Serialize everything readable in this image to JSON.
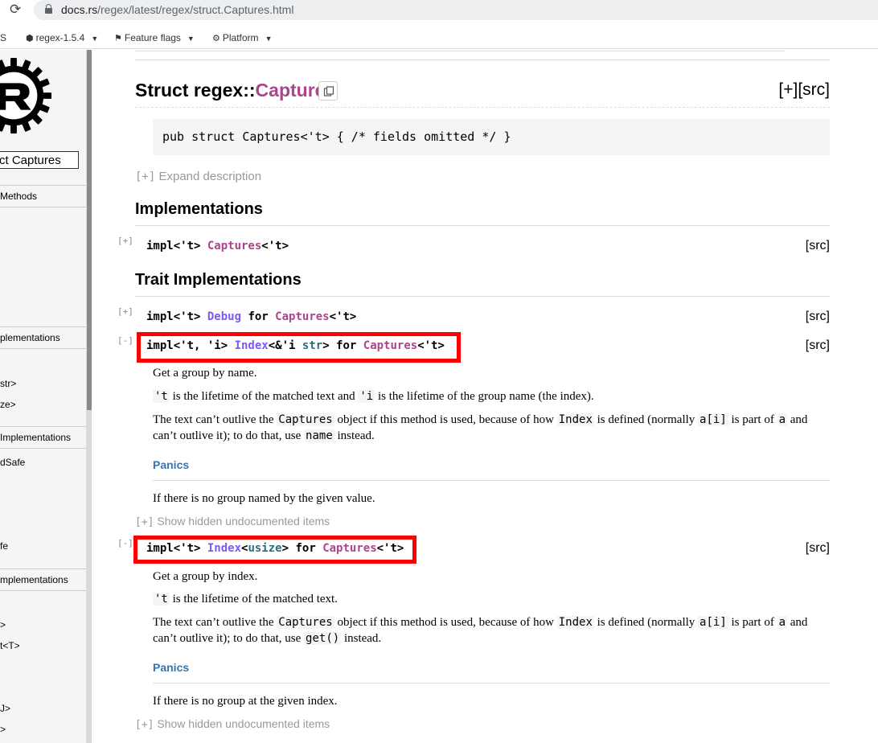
{
  "browser": {
    "url_host": "docs.rs",
    "url_path": "/regex/latest/regex/struct.Captures.html",
    "reload_glyph": "⟳"
  },
  "docsnav": {
    "partial_item": "S",
    "crate_version": "regex-1.5.4",
    "feature_flags": "Feature flags",
    "platform": "Platform",
    "caret": "▼"
  },
  "sidebar": {
    "location": "ct Captures",
    "sections": [
      {
        "label": "Methods"
      },
      {
        "label": "plementations"
      },
      {
        "label": "Implementations"
      },
      {
        "label": "mplementations"
      }
    ],
    "links": [
      "str>",
      "ze>",
      "dSafe",
      "fe",
      ">",
      "t<T>",
      "J>",
      ">"
    ]
  },
  "main": {
    "title_prefix": "Struct regex::",
    "title_name": "Captures",
    "title_src": "[+][src]",
    "declaration": "pub struct Captures<'t> { /* fields omitted */ }",
    "expand_toggle": "[+]",
    "expand_label": "Expand description",
    "implementations_heading": "Implementations",
    "trait_impls_heading": "Trait Implementations",
    "src_label": "[src]",
    "toggle_plus": "[+]",
    "toggle_minus": "[-]",
    "impls": [
      {
        "tokens": [
          [
            "k",
            "impl<'t> "
          ],
          [
            "ty",
            "Captures"
          ],
          [
            "k",
            "<'t>"
          ]
        ]
      },
      {
        "tokens": [
          [
            "k",
            "impl<'t> "
          ],
          [
            "tr",
            "Debug"
          ],
          [
            "k",
            " for "
          ],
          [
            "ty",
            "Captures"
          ],
          [
            "k",
            "<'t>"
          ]
        ]
      },
      {
        "tokens": [
          [
            "k",
            "impl<'t, 'i> "
          ],
          [
            "tr",
            "Index"
          ],
          [
            "k",
            "<&'i "
          ],
          [
            "pr",
            "str"
          ],
          [
            "k",
            "> for "
          ],
          [
            "ty",
            "Captures"
          ],
          [
            "k",
            "<'t>"
          ]
        ]
      },
      {
        "tokens": [
          [
            "k",
            "impl<'t> "
          ],
          [
            "tr",
            "Index"
          ],
          [
            "k",
            "<"
          ],
          [
            "pr",
            "usize"
          ],
          [
            "k",
            "> for "
          ],
          [
            "ty",
            "Captures"
          ],
          [
            "k",
            "<'t>"
          ]
        ]
      }
    ],
    "index_str_docs": {
      "summary": "Get a group by name.",
      "lifetime": [
        [
          "c",
          "'t"
        ],
        [
          "t",
          " is the lifetime of the matched text and "
        ],
        [
          "c",
          "'i"
        ],
        [
          "t",
          " is the lifetime of the group name (the index)."
        ]
      ],
      "outlive": [
        [
          "t",
          "The text can’t outlive the "
        ],
        [
          "c",
          "Captures"
        ],
        [
          "t",
          " object if this method is used, because of how "
        ],
        [
          "c",
          "Index"
        ],
        [
          "t",
          " is defined (normally "
        ],
        [
          "c",
          "a[i]"
        ],
        [
          "t",
          " is part of "
        ],
        [
          "c",
          "a"
        ],
        [
          "t",
          " and can’t outlive it); to do that, use "
        ],
        [
          "c",
          "name"
        ],
        [
          "t",
          " instead."
        ]
      ],
      "panics_heading": "Panics",
      "panics_text": "If there is no group named by the given value."
    },
    "index_usize_docs": {
      "summary": "Get a group by index.",
      "lifetime": [
        [
          "c",
          "'t"
        ],
        [
          "t",
          " is the lifetime of the matched text."
        ]
      ],
      "outlive": [
        [
          "t",
          "The text can’t outlive the "
        ],
        [
          "c",
          "Captures"
        ],
        [
          "t",
          " object if this method is used, because of how "
        ],
        [
          "c",
          "Index"
        ],
        [
          "t",
          " is defined (normally "
        ],
        [
          "c",
          "a[i]"
        ],
        [
          "t",
          " is part of "
        ],
        [
          "c",
          "a"
        ],
        [
          "t",
          " and can’t outlive it); to do that, use "
        ],
        [
          "c",
          "get()"
        ],
        [
          "t",
          " instead."
        ]
      ],
      "panics_heading": "Panics",
      "panics_text": "If there is no group at the given index."
    },
    "hidden_toggle": "[+]",
    "hidden_label": "Show hidden undocumented items"
  },
  "colors": {
    "struct": "#ad448e",
    "trait": "#7c5af3",
    "primitive": "#2a6f80",
    "highlight": "#ff0000",
    "panics": "#3873ad"
  }
}
